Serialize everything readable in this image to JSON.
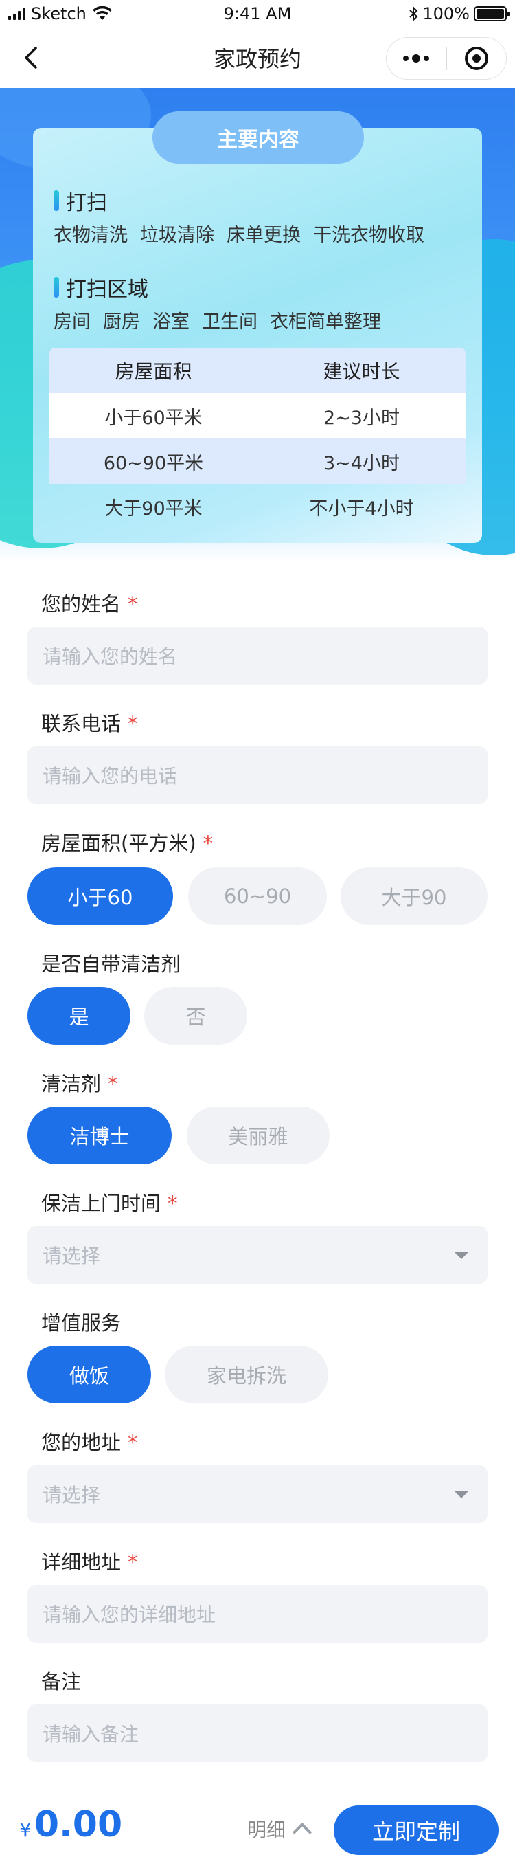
{
  "status_bar": {
    "carrier": "Sketch",
    "time": "9:41 AM",
    "battery": "100%"
  },
  "nav": {
    "title": "家政预约"
  },
  "main_content": {
    "title": "主要内容",
    "sections": [
      {
        "title": "打扫",
        "items": [
          "衣物清洗",
          "垃圾清除",
          "床单更换",
          "干洗衣物收取"
        ]
      },
      {
        "title": "打扫区域",
        "items": [
          "房间",
          "厨房",
          "浴室",
          "卫生间",
          "衣柜简单整理"
        ]
      }
    ],
    "table": {
      "headers": [
        "房屋面积",
        "建议时长"
      ],
      "rows": [
        [
          "小于60平米",
          "2~3小时"
        ],
        [
          "60~90平米",
          "3~4小时"
        ],
        [
          "大于90平米",
          "不小于4小时"
        ]
      ]
    }
  },
  "form": {
    "required_mark": "*",
    "name": {
      "label": "您的姓名",
      "placeholder": "请输入您的姓名"
    },
    "phone": {
      "label": "联系电话",
      "placeholder": "请输入您的电话"
    },
    "area": {
      "label": "房屋面积(平方米)",
      "options": [
        "小于60",
        "60~90",
        "大于90"
      ],
      "selected": "小于60"
    },
    "own_cleaner": {
      "label": "是否自带清洁剂",
      "options": [
        "是",
        "否"
      ],
      "selected": "是"
    },
    "cleaner": {
      "label": "清洁剂",
      "options": [
        "洁博士",
        "美丽雅"
      ],
      "selected": "洁博士"
    },
    "time": {
      "label": "保洁上门时间",
      "placeholder": "请选择"
    },
    "extra": {
      "label": "增值服务",
      "options": [
        "做饭",
        "家电拆洗"
      ],
      "selected": "做饭"
    },
    "address": {
      "label": "您的地址",
      "placeholder": "请选择"
    },
    "detail_address": {
      "label": "详细地址",
      "placeholder": "请输入您的详细地址"
    },
    "note": {
      "label": "备注",
      "placeholder": "请输入备注"
    }
  },
  "bottom": {
    "currency": "¥",
    "price": "0.00",
    "detail_label": "明细",
    "submit_label": "立即定制"
  },
  "colors": {
    "primary": "#1d70e8",
    "required": "#e8453c",
    "input_bg": "#f1f3f6"
  }
}
